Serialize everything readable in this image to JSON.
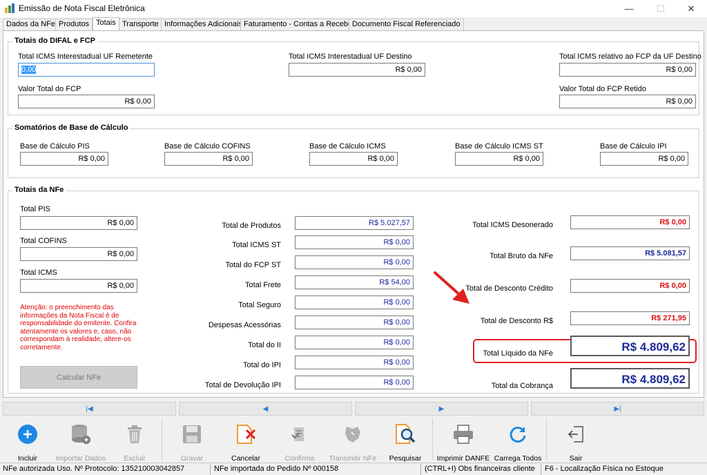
{
  "window": {
    "title": "Emissão de Nota Fiscal Eletrônica",
    "minimize": "—",
    "maximize": "☐",
    "close": "✕"
  },
  "tabs": [
    "Dados da NFe",
    "Produtos",
    "Totais",
    "Transporte",
    "Informações Adicionais",
    "Faturamento - Contas a Receber",
    "Documento Fiscal Referenciado"
  ],
  "difal": {
    "title": "Totais do DIFAL e FCP",
    "icms_remetente": {
      "label": "Total ICMS Interestadual UF Remetente",
      "value": "0,00"
    },
    "icms_destino": {
      "label": "Total ICMS Interestadual UF Destino",
      "value": "R$ 0,00"
    },
    "fcp_uf_destino": {
      "label": "Total ICMS relativo ao FCP da UF Destino",
      "value": "R$ 0,00"
    },
    "valor_fcp": {
      "label": "Valor Total do FCP",
      "value": "R$ 0,00"
    },
    "fcp_retido": {
      "label": "Valor Total do FCP Retido",
      "value": "R$ 0,00"
    }
  },
  "base": {
    "title": "Somatórios de Base de Cálculo",
    "pis": {
      "label": "Base de Cálculo PIS",
      "value": "R$ 0,00"
    },
    "cofins": {
      "label": "Base de Cálculo COFINS",
      "value": "R$ 0,00"
    },
    "icms": {
      "label": "Base de Cálculo ICMS",
      "value": "R$ 0,00"
    },
    "icms_st": {
      "label": "Base de Cálculo ICMS ST",
      "value": "R$ 0,00"
    },
    "ipi": {
      "label": "Base de Cálculo IPI",
      "value": "R$ 0,00"
    }
  },
  "totais": {
    "title": "Totais da NFe",
    "pis": {
      "label": "Total PIS",
      "value": "R$ 0,00"
    },
    "cofins": {
      "label": "Total COFINS",
      "value": "R$ 0,00"
    },
    "icms": {
      "label": "Total ICMS",
      "value": "R$ 0,00"
    },
    "warning": "Atenção: o preenchimento das informações da Nota Fiscal é de responsabilidade do emitente. Confira atentamente os valores e, caso, não correspondam à realidade, altere-os corretamente.",
    "calc_button": "Calcular NFe",
    "produtos": {
      "label": "Total de Produtos",
      "value": "R$ 5.027,57"
    },
    "icms_st": {
      "label": "Total ICMS ST",
      "value": "R$ 0,00"
    },
    "fcp_st": {
      "label": "Total do FCP ST",
      "value": "R$ 0,00"
    },
    "frete": {
      "label": "Total Frete",
      "value": "R$ 54,00"
    },
    "seguro": {
      "label": "Total Seguro",
      "value": "R$ 0,00"
    },
    "despesas": {
      "label": "Despesas Acessórias",
      "value": "R$ 0,00"
    },
    "ii": {
      "label": "Total do II",
      "value": "R$ 0,00"
    },
    "ipi": {
      "label": "Total do IPI",
      "value": "R$ 0,00"
    },
    "devolucao_ipi": {
      "label": "Total de Devolução IPI",
      "value": "R$ 0,00"
    },
    "icms_desonerado": {
      "label": "Total ICMS Desonerado",
      "value": "R$ 0,00"
    },
    "bruto": {
      "label": "Total Bruto da NFe",
      "value": "R$ 5.081,57"
    },
    "desconto_credito": {
      "label": "Total de Desconto Crédito",
      "value": "R$ 0,00"
    },
    "desconto": {
      "label": "Total de Desconto R$",
      "value": "R$ 271,95"
    },
    "liquido": {
      "label": "Total Líquido da NFe",
      "value": "R$ 4.809,62"
    },
    "cobranca": {
      "label": "Total da Cobrança",
      "value": "R$ 4.809,62"
    }
  },
  "nav": [
    "|◀",
    "◀",
    "▶",
    "▶|"
  ],
  "toolbar": {
    "incluir": "Incluir",
    "importar": "Importar Dados",
    "excluir": "Excluir",
    "gravar": "Gravar",
    "cancelar": "Cancelar",
    "confirma": "Confirma",
    "transmitir": "Transmitir NFe",
    "pesquisar": "Pesquisar",
    "imprimir": "Imprimir DANFE",
    "carrega": "Carrega Todos",
    "sair": "Sair"
  },
  "status": {
    "protocolo": "NFe autorizada Uso. Nº Protocolo: 135210003042857",
    "pedido": "NFe importada do Pedido Nº 000158",
    "obs": "(CTRL+I) Obs financeiras cliente",
    "localizacao": "F6 - Localização Física no Estoque"
  },
  "colors": {
    "accent_blue": "#1c2a9c",
    "alert_red": "#e01010",
    "highlight": "#e02020"
  }
}
